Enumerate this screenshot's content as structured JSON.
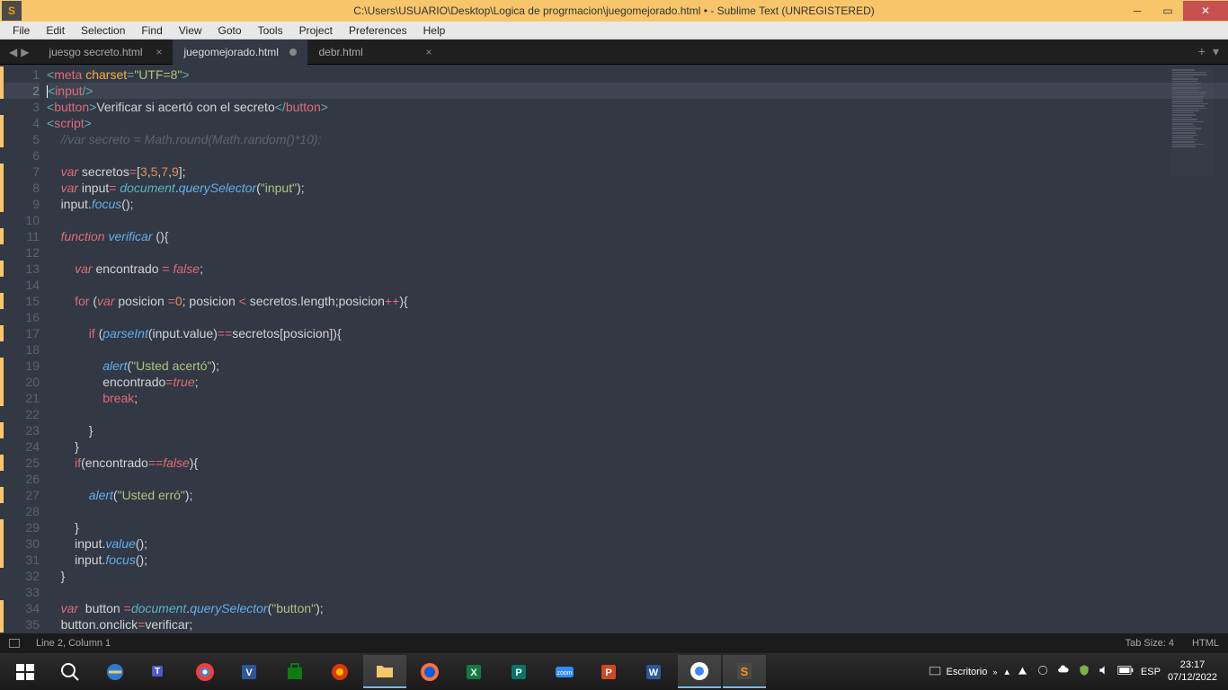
{
  "titlebar": {
    "title": "C:\\Users\\USUARIO\\Desktop\\Logica de progrmacion\\juegomejorado.html • - Sublime Text (UNREGISTERED)",
    "app_icon_letter": "S"
  },
  "menubar": [
    "File",
    "Edit",
    "Selection",
    "Find",
    "View",
    "Goto",
    "Tools",
    "Project",
    "Preferences",
    "Help"
  ],
  "tabs": [
    {
      "label": "juesgo secreto.html",
      "active": false,
      "dirty": false
    },
    {
      "label": "juegomejorado.html",
      "active": true,
      "dirty": true
    },
    {
      "label": "debr.html",
      "active": false,
      "dirty": false
    }
  ],
  "code_lines": [
    {
      "n": 1,
      "html": "<span class='c-punc'>&lt;</span><span class='c-tag'>meta</span> <span class='c-attr'>charset</span><span class='c-punc'>=</span><span class='c-str'>\"UTF=8\"</span><span class='c-punc'>&gt;</span>"
    },
    {
      "n": 2,
      "html": "<span class='cursor'></span><span class='c-punc'>&lt;</span><span class='c-tag'>input</span><span class='c-punc'>/&gt;</span>",
      "highlight": true
    },
    {
      "n": 3,
      "html": "<span class='c-punc'>&lt;</span><span class='c-tag'>button</span><span class='c-punc'>&gt;</span><span class='c-text'>Verificar si acertó con el secreto</span><span class='c-punc'>&lt;/</span><span class='c-tag'>button</span><span class='c-punc'>&gt;</span>"
    },
    {
      "n": 4,
      "html": "<span class='c-punc'>&lt;</span><span class='c-tag'>script</span><span class='c-punc'>&gt;</span>"
    },
    {
      "n": 5,
      "html": "    <span class='c-comment'>//var secreto = Math.round(Math.random()*10);</span>"
    },
    {
      "n": 6,
      "html": ""
    },
    {
      "n": 7,
      "html": "    <span class='c-kw'>var</span> <span class='c-text'>secretos</span><span class='c-op'>=</span><span class='c-text'>[</span><span class='c-num'>3</span><span class='c-text'>,</span><span class='c-num'>5</span><span class='c-text'>,</span><span class='c-num'>7</span><span class='c-text'>,</span><span class='c-num'>9</span><span class='c-text'>];</span>"
    },
    {
      "n": 8,
      "html": "    <span class='c-kw'>var</span> <span class='c-text'>input</span><span class='c-op'>=</span> <span class='c-support'>document</span><span class='c-text'>.</span><span class='c-name'>querySelector</span><span class='c-text'>(</span><span class='c-str'>\"input\"</span><span class='c-text'>);</span>"
    },
    {
      "n": 9,
      "html": "    <span class='c-text'>input.</span><span class='c-name'>focus</span><span class='c-text'>();</span>"
    },
    {
      "n": 10,
      "html": ""
    },
    {
      "n": 11,
      "html": "    <span class='c-kw'>function</span> <span class='c-name'>verificar</span> <span class='c-text'>(){</span>"
    },
    {
      "n": 12,
      "html": ""
    },
    {
      "n": 13,
      "html": "        <span class='c-kw'>var</span> <span class='c-text'>encontrado </span><span class='c-op'>=</span> <span class='c-const'>false</span><span class='c-text'>;</span>"
    },
    {
      "n": 14,
      "html": ""
    },
    {
      "n": 15,
      "html": "        <span class='c-kw2'>for</span> <span class='c-text'>(</span><span class='c-kw'>var</span> <span class='c-text'>posicion </span><span class='c-op'>=</span><span class='c-num'>0</span><span class='c-text'>; posicion </span><span class='c-op'>&lt;</span><span class='c-text'> secretos.length;posicion</span><span class='c-op'>++</span><span class='c-text'>){</span>"
    },
    {
      "n": 16,
      "html": ""
    },
    {
      "n": 17,
      "html": "            <span class='c-kw2'>if</span> <span class='c-text'>(</span><span class='c-name'>parseInt</span><span class='c-text'>(input.value)</span><span class='c-op'>==</span><span class='c-text'>secretos[posicion]){</span>"
    },
    {
      "n": 18,
      "html": ""
    },
    {
      "n": 19,
      "html": "                <span class='c-name'>alert</span><span class='c-text'>(</span><span class='c-str'>\"Usted acertó\"</span><span class='c-text'>);</span>"
    },
    {
      "n": 20,
      "html": "                <span class='c-text'>encontrado</span><span class='c-op'>=</span><span class='c-const'>true</span><span class='c-text'>;</span>"
    },
    {
      "n": 21,
      "html": "                <span class='c-kw2'>break</span><span class='c-text'>;</span>"
    },
    {
      "n": 22,
      "html": ""
    },
    {
      "n": 23,
      "html": "            <span class='c-text'>}</span>"
    },
    {
      "n": 24,
      "html": "        <span class='c-text'>}</span>"
    },
    {
      "n": 25,
      "html": "        <span class='c-kw2'>if</span><span class='c-text'>(encontrado</span><span class='c-op'>==</span><span class='c-const'>false</span><span class='c-text'>){</span>"
    },
    {
      "n": 26,
      "html": ""
    },
    {
      "n": 27,
      "html": "            <span class='c-name'>alert</span><span class='c-text'>(</span><span class='c-str'>\"Usted erró\"</span><span class='c-text'>);</span>"
    },
    {
      "n": 28,
      "html": ""
    },
    {
      "n": 29,
      "html": "        <span class='c-text'>}</span>"
    },
    {
      "n": 30,
      "html": "        <span class='c-text'>input.</span><span class='c-name'>value</span><span class='c-text'>();</span>"
    },
    {
      "n": 31,
      "html": "        <span class='c-text'>input.</span><span class='c-name'>focus</span><span class='c-text'>();</span>"
    },
    {
      "n": 32,
      "html": "    <span class='c-text'>}</span>"
    },
    {
      "n": 33,
      "html": ""
    },
    {
      "n": 34,
      "html": "    <span class='c-kw'>var</span>  <span class='c-text'>button </span><span class='c-op'>=</span><span class='c-support'>document</span><span class='c-text'>.</span><span class='c-name'>querySelector</span><span class='c-text'>(</span><span class='c-str'>\"button\"</span><span class='c-text'>);</span>"
    },
    {
      "n": 35,
      "html": "    <span class='c-text'>button.onclick</span><span class='c-op'>=</span><span class='c-text'>verificar;</span>"
    }
  ],
  "statusbar": {
    "left": "Line 2, Column 1",
    "tab_size": "Tab Size: 4",
    "syntax": "HTML"
  },
  "taskbar": {
    "tray_label": "Escritorio",
    "time": "23:17",
    "date": "07/12/2022"
  }
}
